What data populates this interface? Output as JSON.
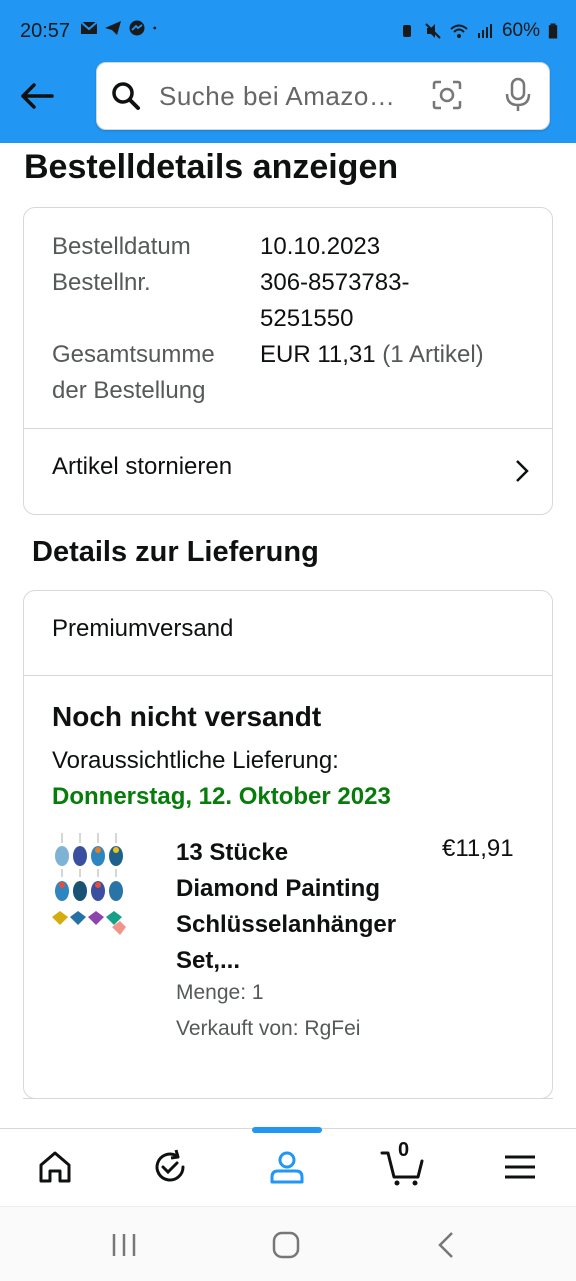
{
  "status_bar": {
    "time": "20:57",
    "battery": "60%",
    "left_icons": [
      "mail-icon",
      "telegram-icon",
      "messenger-icon",
      "dot-icon"
    ],
    "right_icons": [
      "alarm-icon",
      "mute-icon",
      "wifi-icon",
      "signal-icon",
      "battery-icon"
    ]
  },
  "header": {
    "back_icon": "arrow-left-icon",
    "search_placeholder": "Suche bei Amazo…",
    "search_icon": "search-icon",
    "camera_icon": "camera-scan-icon",
    "mic_icon": "microphone-icon"
  },
  "page_title": "Bestelldetails anzeigen",
  "order": {
    "date_label": "Bestelldatum",
    "date_value": "10.10.2023",
    "number_label": "Bestellnr.",
    "number_value_line1": "306-8573783-",
    "number_value_line2": "5251550",
    "total_label_line1": "Gesamtsumme",
    "total_label_line2": "der Bestellung",
    "total_value": "EUR 11,31",
    "total_items": "(1 Artikel)",
    "cancel_label": "Artikel stornieren"
  },
  "delivery": {
    "section_title": "Details zur Lieferung",
    "shipping_type": "Premiumversand",
    "status": "Noch nicht versandt",
    "eta_label": "Voraussichtliche Lieferung:",
    "eta_date": "Donnerstag, 12. Oktober 2023",
    "eta_color": "#067d0a",
    "product": {
      "name_line1": "13 Stücke",
      "name_line2": "Diamond Painting",
      "name_line3": "Schlüsselanhänger",
      "name_line4": "Set,...",
      "price": "€11,91",
      "quantity": "Menge: 1",
      "seller": "Verkauft von: RgFei"
    }
  },
  "bottom_nav": {
    "items": [
      "home-icon",
      "orders-refresh-icon",
      "account-icon",
      "cart-icon",
      "menu-icon"
    ],
    "cart_count": "0",
    "active": "account-icon",
    "accent": "#2196f3"
  },
  "system_nav": [
    "recent-apps-icon",
    "home-circle-icon",
    "back-chevron-icon"
  ]
}
